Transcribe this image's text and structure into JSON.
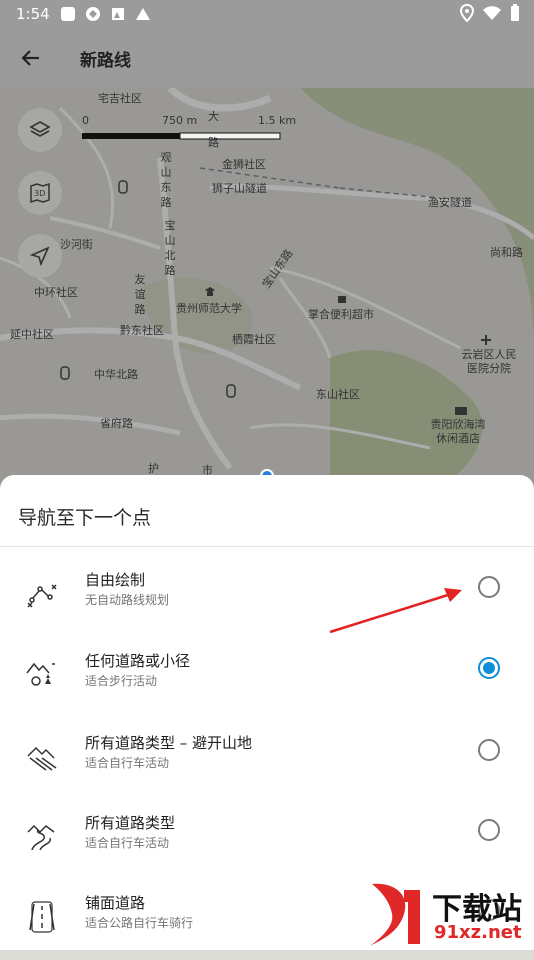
{
  "status": {
    "time": "1:54",
    "icons": [
      "square-icon",
      "shield-icon",
      "photo-icon",
      "triangle-icon"
    ],
    "right_icons": [
      "location-icon",
      "wifi-icon",
      "battery-icon"
    ]
  },
  "app_bar": {
    "title": "新路线"
  },
  "map": {
    "scale_labels": [
      "0",
      "750 m",
      "1.5 km"
    ],
    "labels": [
      {
        "text": "宅吉社区"
      },
      {
        "text": "金狮社区"
      },
      {
        "text": "狮子山隧道"
      },
      {
        "text": "渔安隧道"
      },
      {
        "text": "尚和路"
      },
      {
        "text": "沙河街"
      },
      {
        "text": "中环社区"
      },
      {
        "text": "延中社区"
      },
      {
        "text": "黔东社区"
      },
      {
        "text": "贵州师范大学"
      },
      {
        "text": "掌合便利超市"
      },
      {
        "text": "栖霞社区"
      },
      {
        "text": "中华北路"
      },
      {
        "text": "省府路"
      },
      {
        "text": "东山社区"
      },
      {
        "text": "云岩区人民医院分院"
      },
      {
        "text": "贵阳欣海湾休闲酒店"
      },
      {
        "text": "观山东路"
      },
      {
        "text": "宝山北路"
      },
      {
        "text": "友谊路"
      },
      {
        "text": "大"
      },
      {
        "text": "路"
      },
      {
        "text": "市"
      },
      {
        "text": "护"
      },
      {
        "text": "宝山东路"
      }
    ]
  },
  "sheet": {
    "title": "导航至下一个点",
    "options": [
      {
        "title": "自由绘制",
        "subtitle": "无自动路线规划",
        "selected": false
      },
      {
        "title": "任何道路或小径",
        "subtitle": "适合步行活动",
        "selected": true
      },
      {
        "title": "所有道路类型 – 避开山地",
        "subtitle": "适合自行车活动",
        "selected": false
      },
      {
        "title": "所有道路类型",
        "subtitle": "适合自行车活动",
        "selected": false
      },
      {
        "title": "铺面道路",
        "subtitle": "适合公路自行车骑行",
        "selected": false
      }
    ]
  },
  "watermark": {
    "brand": "下载站",
    "site": "91xz.net"
  },
  "colors": {
    "accent": "#0f8fd8",
    "annotation_arrow": "#e32222"
  }
}
